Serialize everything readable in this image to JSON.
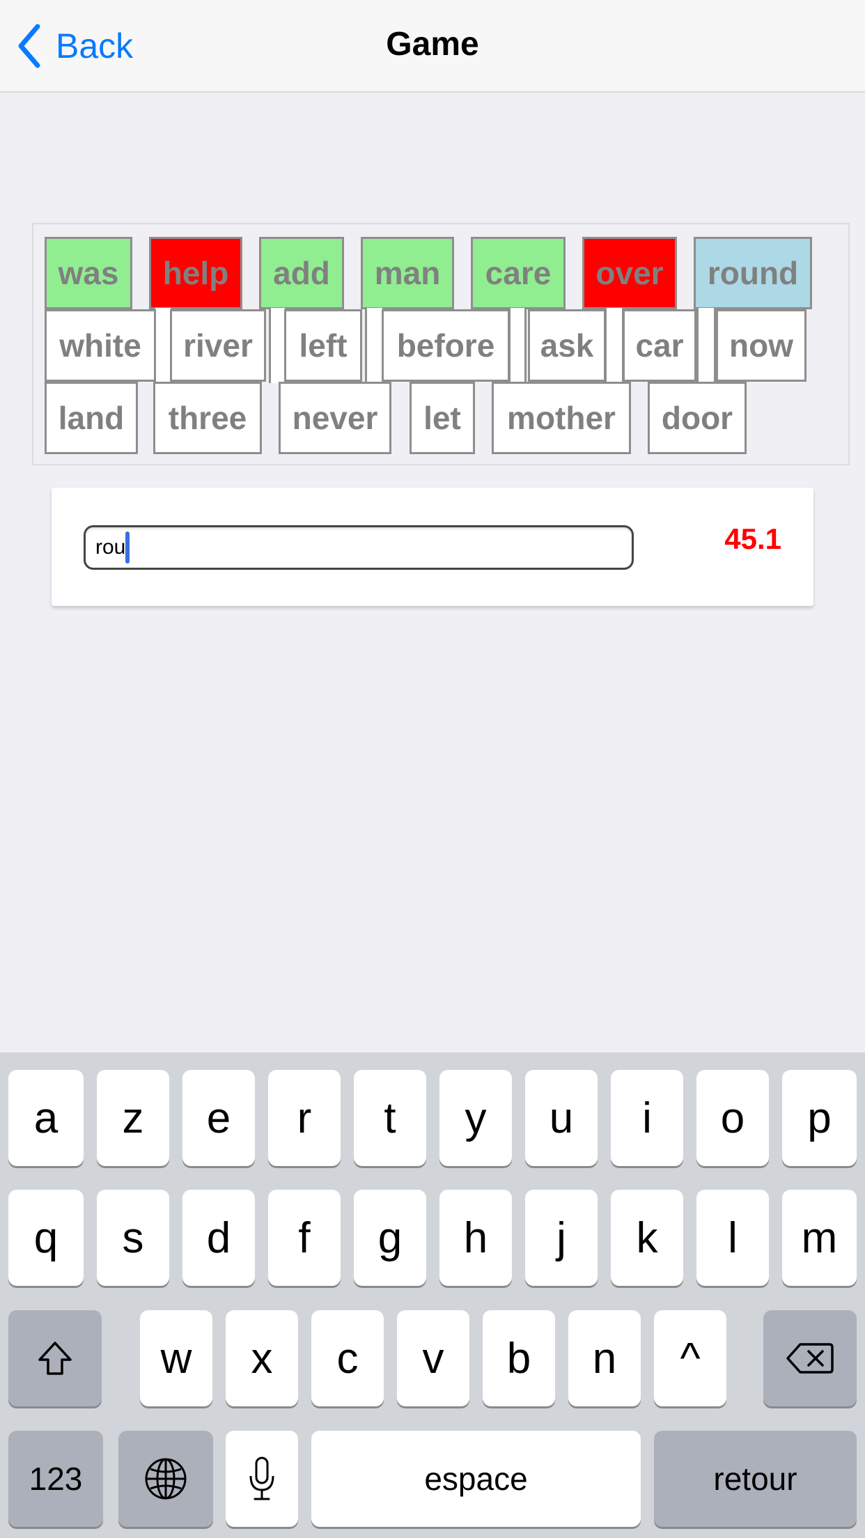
{
  "nav": {
    "back_label": "Back",
    "title": "Game"
  },
  "words": {
    "row1": [
      {
        "text": "was",
        "state": "correct"
      },
      {
        "text": "help",
        "state": "wrong"
      },
      {
        "text": "add",
        "state": "correct"
      },
      {
        "text": "man",
        "state": "correct"
      },
      {
        "text": "care",
        "state": "correct"
      },
      {
        "text": "over",
        "state": "wrong"
      },
      {
        "text": "round",
        "state": "current"
      }
    ],
    "row2": [
      {
        "text": "white",
        "state": "pending"
      },
      {
        "text": "river",
        "state": "pending"
      },
      {
        "text": "left",
        "state": "pending"
      },
      {
        "text": "before",
        "state": "pending"
      },
      {
        "text": "ask",
        "state": "pending"
      },
      {
        "text": "car",
        "state": "pending"
      },
      {
        "text": "now",
        "state": "pending"
      }
    ],
    "row3": [
      {
        "text": "land",
        "state": "pending"
      },
      {
        "text": "three",
        "state": "pending"
      },
      {
        "text": "never",
        "state": "pending"
      },
      {
        "text": "let",
        "state": "pending"
      },
      {
        "text": "mother",
        "state": "pending"
      },
      {
        "text": "door",
        "state": "pending"
      }
    ]
  },
  "state_colors": {
    "correct": "#90ee90",
    "wrong": "#ff0000",
    "current": "#add8e6",
    "pending": "#ffffff"
  },
  "input": {
    "value": "rou"
  },
  "timer": {
    "value": "45.1",
    "color": "#ff0000"
  },
  "keyboard": {
    "row1": [
      "a",
      "z",
      "e",
      "r",
      "t",
      "y",
      "u",
      "i",
      "o",
      "p"
    ],
    "row2": [
      "q",
      "s",
      "d",
      "f",
      "g",
      "h",
      "j",
      "k",
      "l",
      "m"
    ],
    "row3": [
      "w",
      "x",
      "c",
      "v",
      "b",
      "n",
      "^"
    ],
    "numbers_label": "123",
    "space_label": "espace",
    "return_label": "retour",
    "icons": {
      "shift": "shift-icon",
      "delete": "delete-icon",
      "globe": "globe-icon",
      "mic": "microphone-icon"
    }
  }
}
